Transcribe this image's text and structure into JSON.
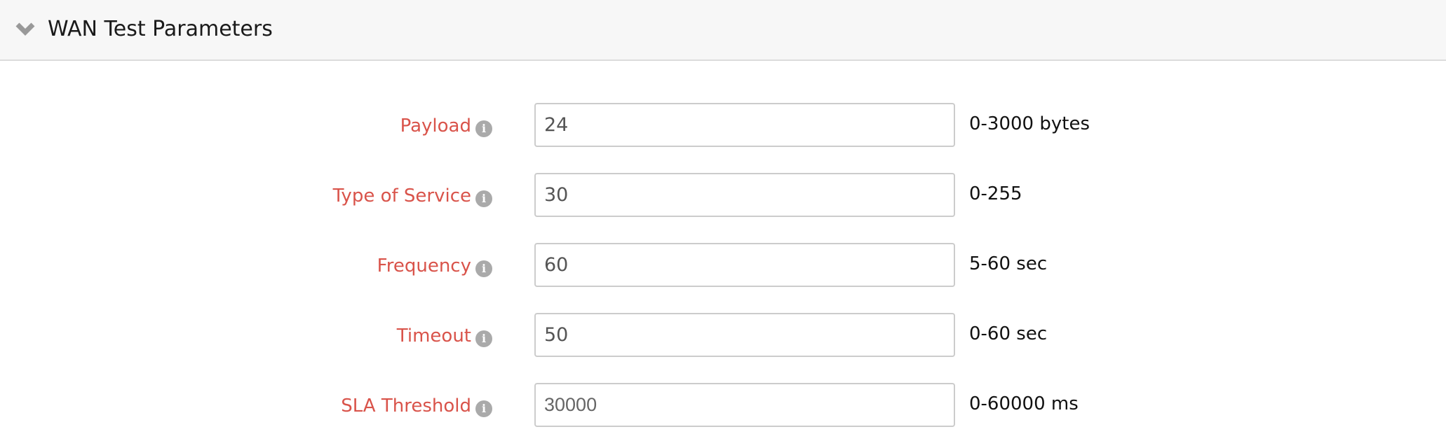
{
  "panel": {
    "title": "WAN Test Parameters",
    "collapse_icon": "chevron-down-icon"
  },
  "colors": {
    "label": "#d9534a",
    "info_icon": "#aaaaaa",
    "header_bg": "#f7f7f7"
  },
  "fields": [
    {
      "label": "Payload",
      "value": "24",
      "placeholder": "",
      "hint": "0-3000 bytes",
      "icon": "info-icon"
    },
    {
      "label": "Type of Service",
      "value": "30",
      "placeholder": "",
      "hint": "0-255",
      "icon": "info-icon"
    },
    {
      "label": "Frequency",
      "value": "60",
      "placeholder": "",
      "hint": "5-60 sec",
      "icon": "info-icon"
    },
    {
      "label": "Timeout",
      "value": "50",
      "placeholder": "",
      "hint": "0-60 sec",
      "icon": "info-icon"
    },
    {
      "label": "SLA Threshold",
      "value": "",
      "placeholder": "30000",
      "hint": "0-60000 ms",
      "icon": "info-icon"
    }
  ]
}
